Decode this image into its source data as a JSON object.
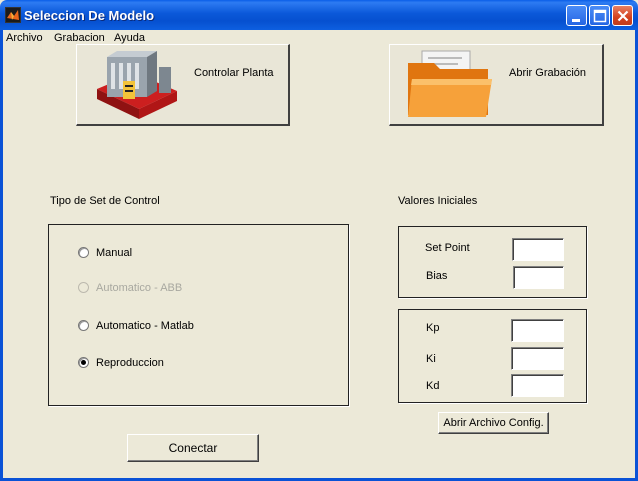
{
  "window": {
    "title": "Seleccion De Modelo",
    "controls": [
      "minimize-icon",
      "maximize-icon",
      "close-icon"
    ]
  },
  "menu": {
    "items": [
      "Archivo",
      "Grabacion",
      "Ayuda"
    ]
  },
  "toolbar": {
    "controlar_label": "Controlar Planta",
    "abrir_grabacion_label": "Abrir Grabación"
  },
  "control_set": {
    "title": "Tipo de Set de Control",
    "options": [
      {
        "label": "Manual",
        "checked": false,
        "enabled": true
      },
      {
        "label": "Automatico - ABB",
        "checked": false,
        "enabled": false
      },
      {
        "label": "Automatico - Matlab",
        "checked": false,
        "enabled": true
      },
      {
        "label": "Reproduccion",
        "checked": true,
        "enabled": true
      }
    ]
  },
  "initial_values": {
    "title": "Valores Iniciales",
    "setpoint_label": "Set Point",
    "setpoint_value": "",
    "bias_label": "Bias",
    "bias_value": ""
  },
  "pid": {
    "kp_label": "Kp",
    "kp_value": "",
    "ki_label": "Ki",
    "ki_value": "",
    "kd_label": "Kd",
    "kd_value": ""
  },
  "buttons": {
    "abrir_config_label": "Abrir Archivo Config.",
    "conectar_label": "Conectar"
  },
  "colors": {
    "titlebar": "#0b58d9",
    "window_bg": "#ece9d8",
    "close_button": "#d3411e"
  }
}
